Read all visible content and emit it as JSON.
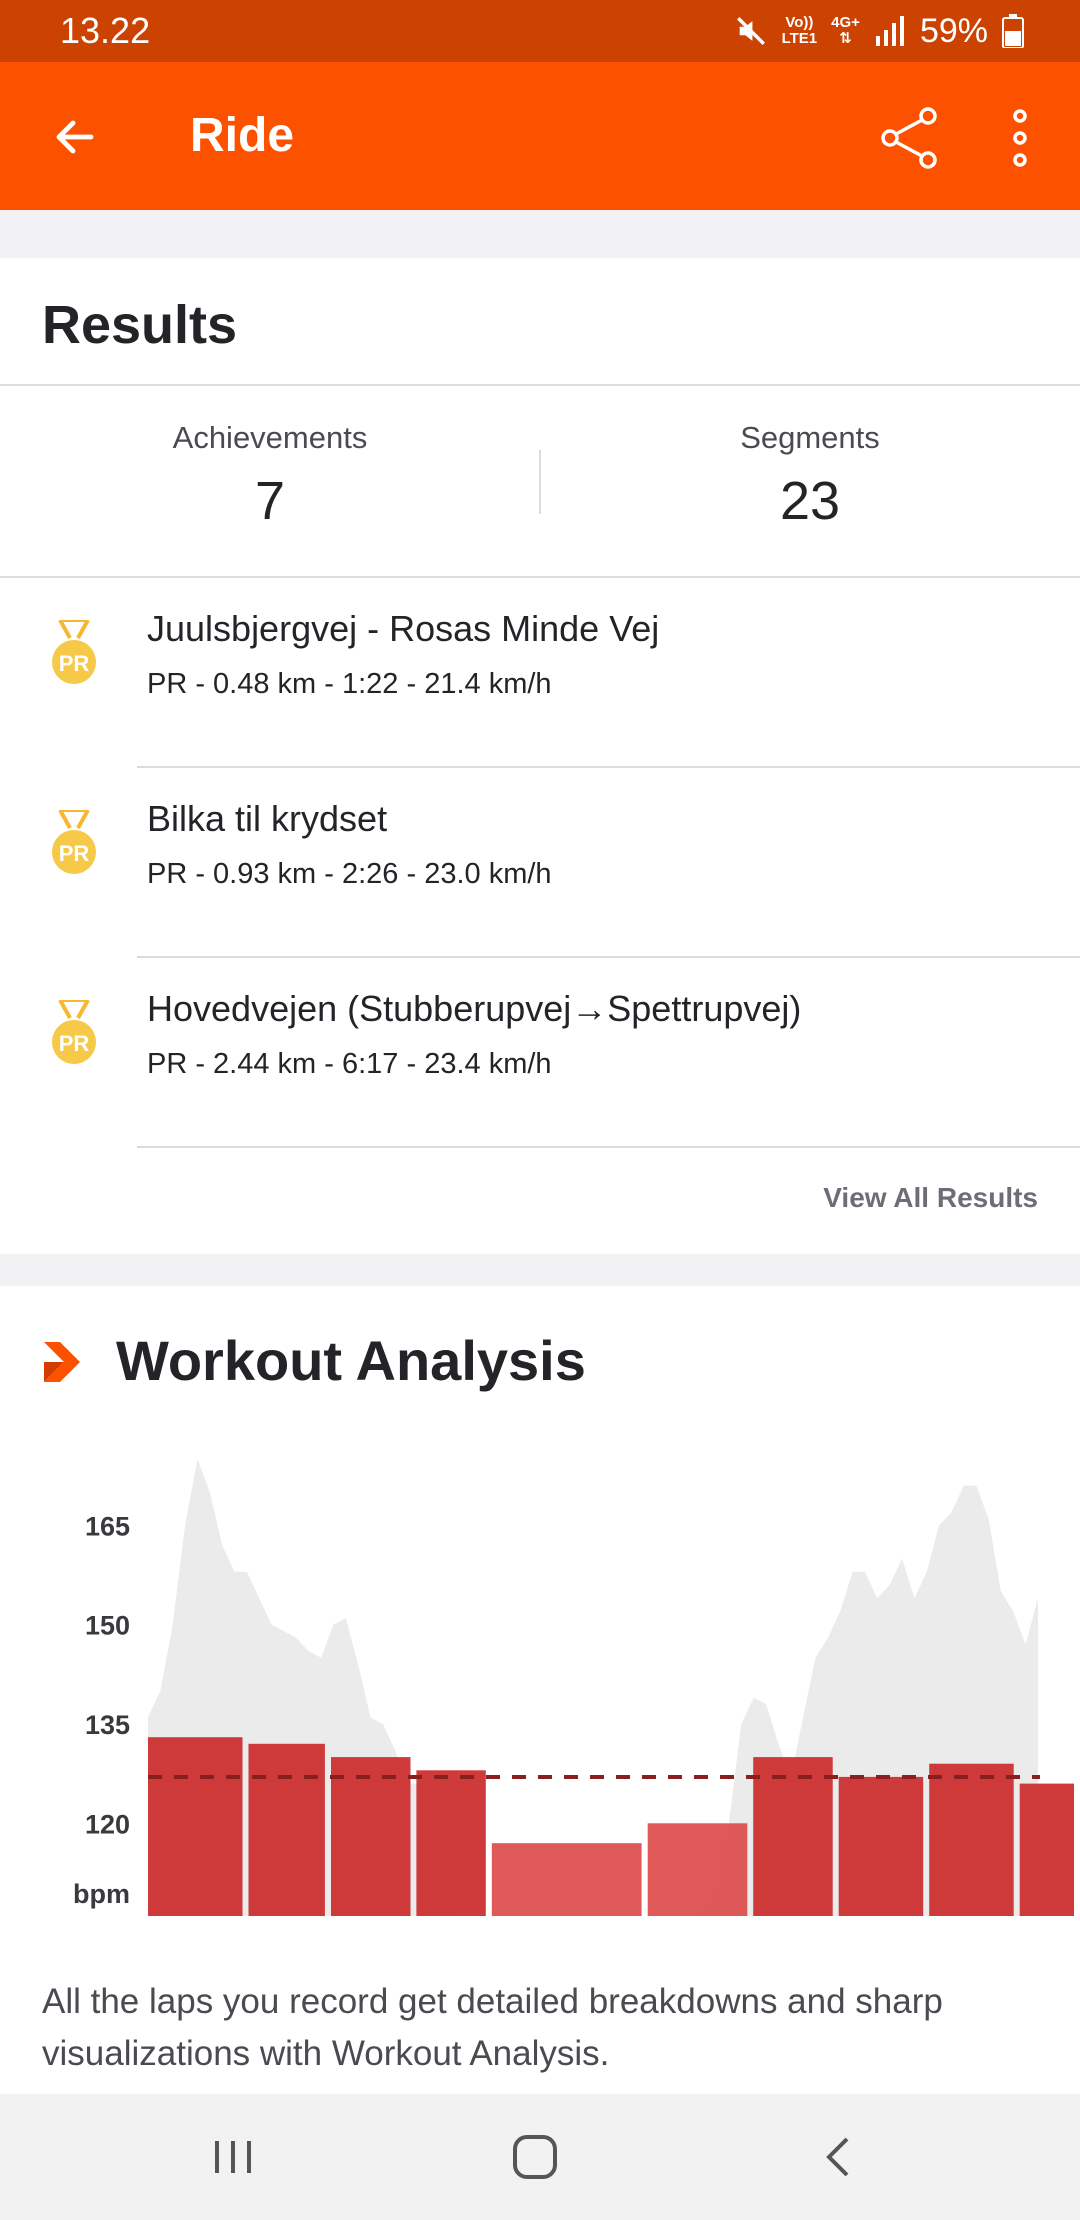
{
  "status_bar": {
    "time": "13.22",
    "network_top": "Vo))",
    "network_bottom": "LTE1",
    "network_type": "4G+",
    "battery": "59%"
  },
  "app_bar": {
    "title": "Ride",
    "back_icon": "arrow-left-icon",
    "share_icon": "share-icon",
    "more_icon": "more-vertical-icon"
  },
  "results": {
    "title": "Results",
    "achievements_label": "Achievements",
    "achievements_value": "7",
    "segments_label": "Segments",
    "segments_value": "23",
    "items": [
      {
        "badge": "PR",
        "name": "Juulsbjergvej - Rosas Minde Vej",
        "stats": "PR - 0.48 km - 1:22 - 21.4 km/h"
      },
      {
        "badge": "PR",
        "name": "Bilka til krydset",
        "stats": "PR - 0.93 km - 2:26 - 23.0 km/h"
      },
      {
        "badge": "PR",
        "name": "Hovedvejen (Stubberupvej→Spettrupvej)",
        "stats": "PR - 2.44 km - 6:17 - 23.4 km/h"
      }
    ],
    "view_all": "View All Results"
  },
  "workout_analysis": {
    "title": "Workout Analysis",
    "description": "All the laps you record get detailed breakdowns and sharp visualizations with Workout Analysis."
  },
  "chart_data": {
    "type": "bar",
    "ylabel": "bpm",
    "y_ticks": [
      120,
      135,
      150,
      165
    ],
    "ylim": [
      106,
      180
    ],
    "average": 127,
    "laps": [
      {
        "value": 133,
        "width": 1.0
      },
      {
        "value": 132,
        "width": 0.82
      },
      {
        "value": 130,
        "width": 0.85
      },
      {
        "value": 128,
        "width": 0.75
      },
      {
        "value": 117,
        "width": 1.55
      },
      {
        "value": 120,
        "width": 1.05
      },
      {
        "value": 130,
        "width": 0.85
      },
      {
        "value": 127,
        "width": 0.9
      },
      {
        "value": 129,
        "width": 0.9
      },
      {
        "value": 126,
        "width": 0.6
      }
    ],
    "background_trace": [
      136,
      140,
      150,
      165,
      175,
      170,
      162,
      158,
      158,
      154,
      150,
      149,
      148,
      146,
      145,
      150,
      151,
      144,
      136,
      135,
      131,
      126,
      126,
      124,
      118,
      106,
      106,
      106,
      106,
      106,
      106,
      106,
      106,
      106,
      106,
      106,
      106,
      106,
      106,
      106,
      106,
      106,
      106,
      106,
      106,
      107,
      110,
      120,
      135,
      139,
      138,
      132,
      127,
      136,
      145,
      148,
      152,
      158,
      158,
      154,
      156,
      160,
      154,
      158,
      165,
      167,
      171,
      171,
      166,
      155,
      152,
      147,
      154
    ]
  },
  "nav_bar": {
    "recents_icon": "recents-icon",
    "home_icon": "home-icon",
    "back_icon": "nav-back-icon"
  }
}
